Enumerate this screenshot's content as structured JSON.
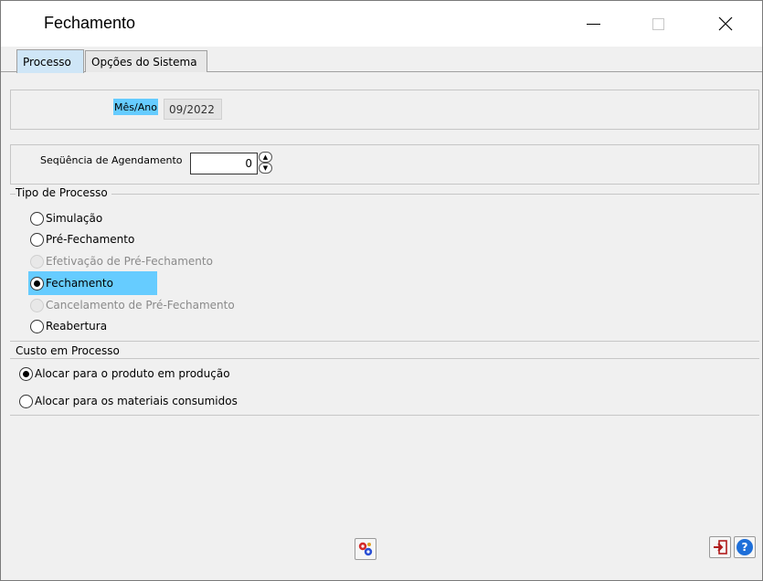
{
  "window": {
    "title": "Fechamento"
  },
  "tabs": [
    {
      "label": "Processo",
      "active": true
    },
    {
      "label": "Opções do Sistema",
      "active": false
    }
  ],
  "mes_ano": {
    "label": "Mês/Ano",
    "value": "09/2022"
  },
  "sequencia": {
    "label": "Seqüência de Agendamento",
    "value": "0"
  },
  "tipo_processo": {
    "legend": "Tipo de Processo",
    "options": [
      {
        "label": "Simulação",
        "checked": false,
        "enabled": true
      },
      {
        "label": "Pré-Fechamento",
        "checked": false,
        "enabled": true
      },
      {
        "label": "Efetivação de Pré-Fechamento",
        "checked": false,
        "enabled": false
      },
      {
        "label": "Fechamento",
        "checked": true,
        "enabled": true
      },
      {
        "label": "Cancelamento de Pré-Fechamento",
        "checked": false,
        "enabled": false
      },
      {
        "label": "Reabertura",
        "checked": false,
        "enabled": true
      }
    ]
  },
  "custo_processo": {
    "legend": "Custo em Processo",
    "options": [
      {
        "label": "Alocar para o produto em produção",
        "checked": true
      },
      {
        "label": "Alocar para os materiais consumidos",
        "checked": false
      }
    ]
  },
  "colors": {
    "highlight": "#66ccff",
    "help_blue": "#1e6fd9",
    "exit_red": "#b01c1c"
  },
  "icons": {
    "process": "gears-icon",
    "exit": "exit-icon",
    "help": "help-icon"
  }
}
